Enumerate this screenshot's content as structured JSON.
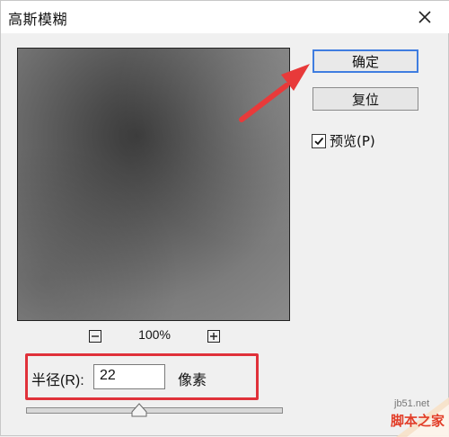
{
  "dialog": {
    "title": "高斯模糊",
    "close_icon": "close-icon"
  },
  "preview": {
    "zoom_out_icon": "minus-icon",
    "zoom_in_icon": "plus-icon",
    "zoom_level": "100%"
  },
  "buttons": {
    "ok_label": "确定",
    "reset_label": "复位"
  },
  "preview_toggle": {
    "label": "预览(P)",
    "checked": true
  },
  "radius": {
    "label": "半径(R):",
    "value": "22",
    "unit": "像素",
    "slider_fraction": 0.44
  },
  "annotation": {
    "arrow_color": "#e83a3a",
    "highlight_color": "#e0313a"
  },
  "watermark": {
    "site": "jb51.net",
    "name": "脚本之家"
  },
  "colors": {
    "accent": "#3f7de0",
    "dialog_bg": "#f0f0f0"
  }
}
